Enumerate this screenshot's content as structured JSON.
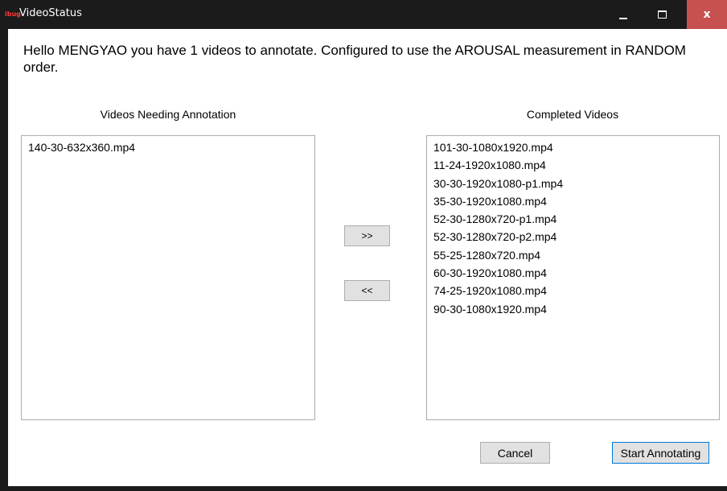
{
  "window": {
    "title": "VideoStatus",
    "icon_text": "ibug",
    "icon_color": "#ff3b3b",
    "close_color": "#c75050",
    "controls": {
      "minimize_icon": "minimize-icon",
      "maximize_icon": "maximize-icon",
      "close_label": "x"
    }
  },
  "greeting": "Hello MENGYAO you have 1 videos to annotate. Configured to use the AROUSAL measurement in RANDOM order.",
  "pending": {
    "label": "Videos Needing Annotation",
    "items": [
      "140-30-632x360.mp4"
    ]
  },
  "completed": {
    "label": "Completed Videos",
    "items": [
      "101-30-1080x1920.mp4",
      "11-24-1920x1080.mp4",
      "30-30-1920x1080-p1.mp4",
      "35-30-1920x1080.mp4",
      "52-30-1280x720-p1.mp4",
      "52-30-1280x720-p2.mp4",
      "55-25-1280x720.mp4",
      "60-30-1920x1080.mp4",
      "74-25-1920x1080.mp4",
      "90-30-1080x1920.mp4"
    ]
  },
  "buttons": {
    "move_right": ">>",
    "move_left": "<<",
    "cancel": "Cancel",
    "start": "Start Annotating"
  }
}
